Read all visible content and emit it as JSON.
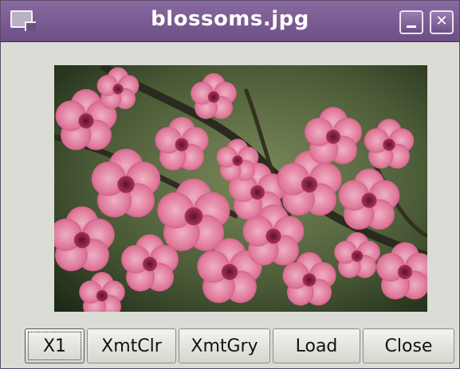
{
  "window": {
    "title": "blossoms.jpg"
  },
  "titlebar_buttons": {
    "minimize_glyph": "_",
    "close_glyph": "✕"
  },
  "buttons": [
    {
      "label": "X1"
    },
    {
      "label": "XmtClr"
    },
    {
      "label": "XmtGry"
    },
    {
      "label": "Load"
    },
    {
      "label": "Close"
    }
  ],
  "colors": {
    "titlebar": "#6b4f85",
    "window_bg": "#dcdcd6",
    "blossom_pink": "#e46a96"
  }
}
